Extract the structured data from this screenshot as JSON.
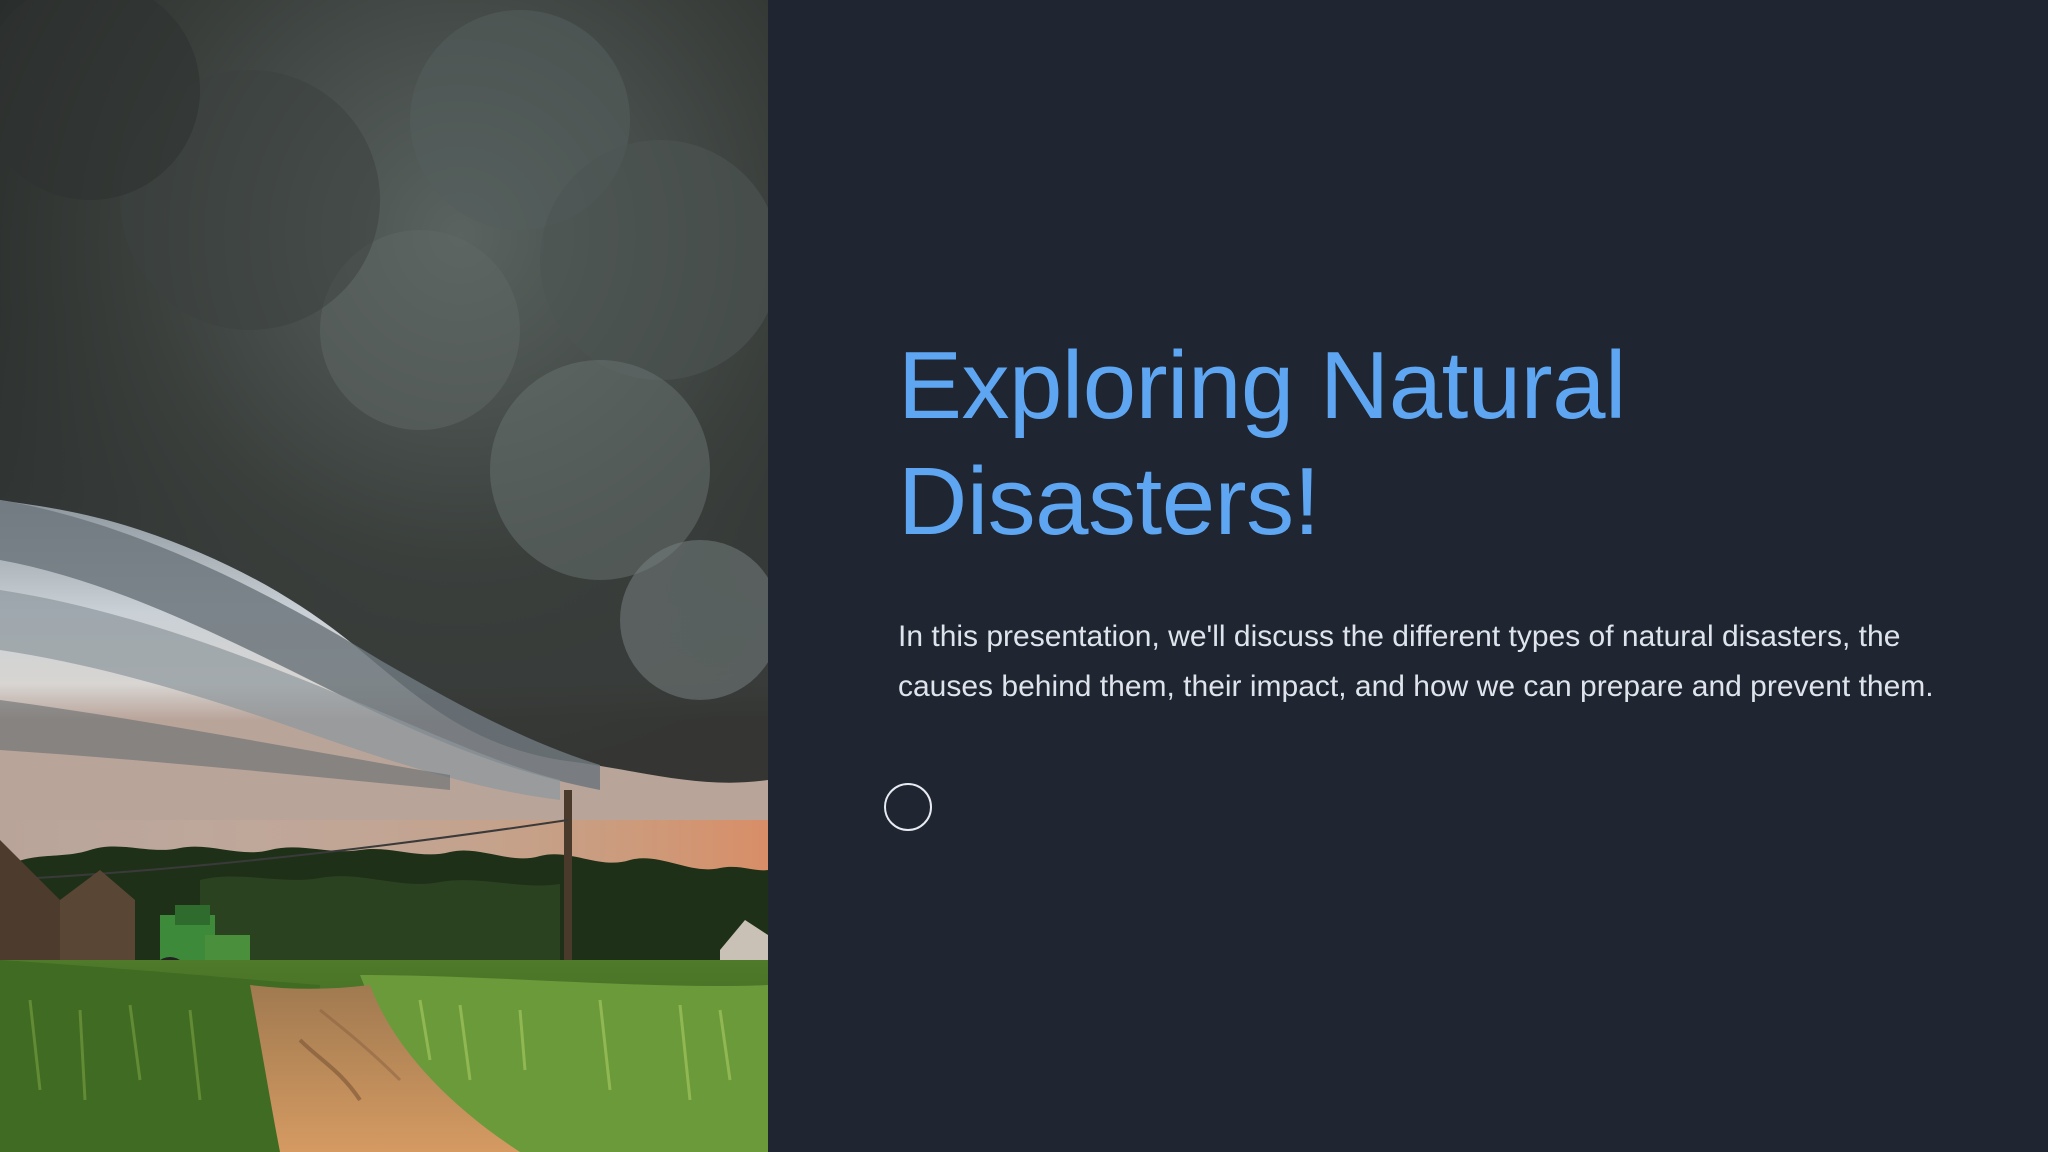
{
  "slide": {
    "title": "Exploring Natural Disasters!",
    "subtitle": "In this presentation, we'll discuss the different types of natural disasters, the causes behind them, their impact, and how we can prepare and prevent them."
  },
  "image": {
    "subject": "storm-clouds-over-farm-photo"
  },
  "colors": {
    "background": "#1f2531",
    "title": "#5ea6f2",
    "body_text": "#dfe4ec"
  }
}
